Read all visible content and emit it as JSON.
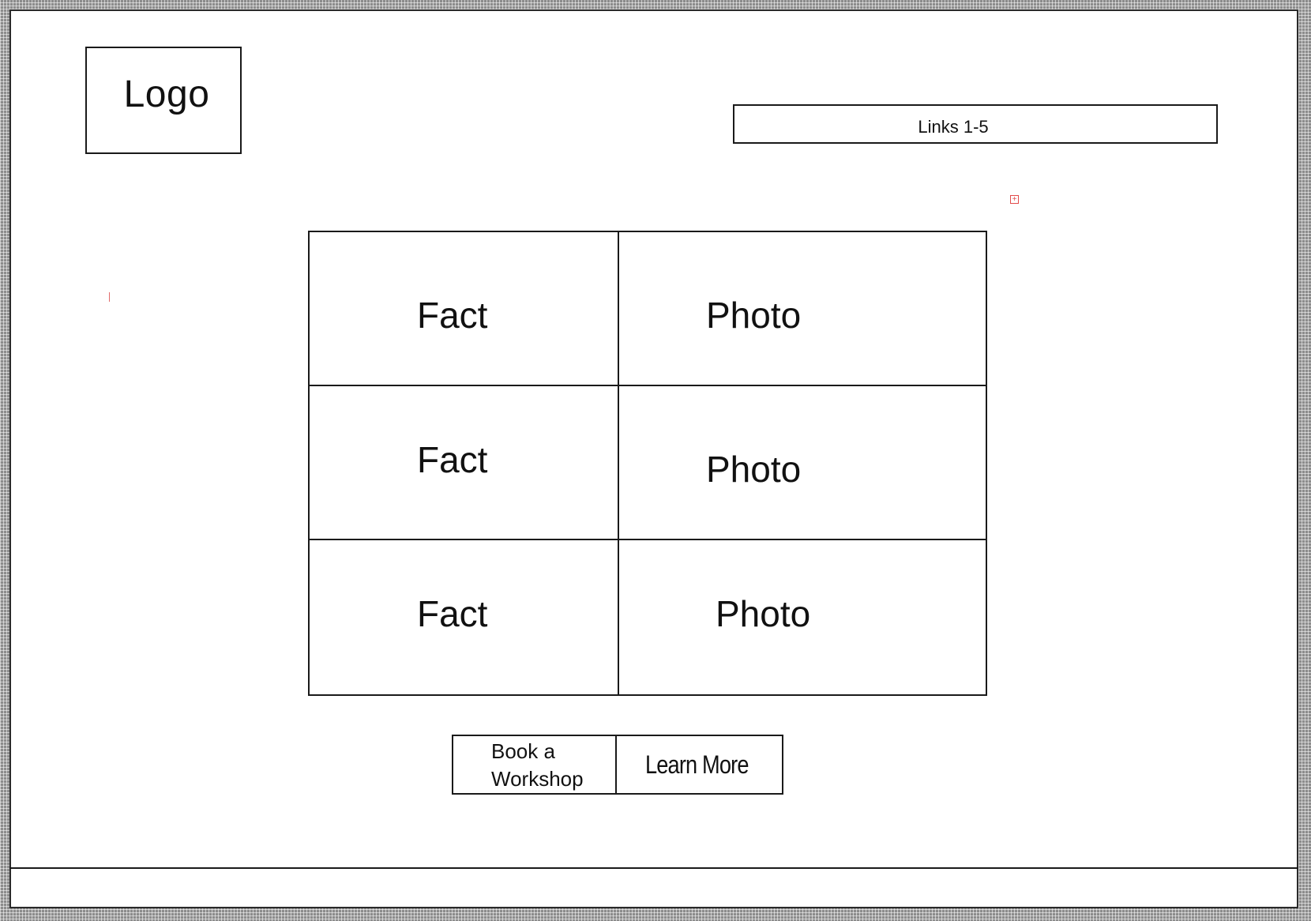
{
  "header": {
    "logo_label": "Logo",
    "links_label": "Links 1-5"
  },
  "grid": {
    "rows": [
      {
        "fact": "Fact",
        "photo": "Photo"
      },
      {
        "fact": "Fact",
        "photo": "Photo"
      },
      {
        "fact": "Fact",
        "photo": "Photo"
      }
    ]
  },
  "actions": {
    "book_label": "Book a\nWorkshop",
    "learn_label": "Learn More"
  },
  "icons": {
    "marker": "plus-square-icon"
  },
  "colors": {
    "stroke": "#1a1a1a",
    "marker": "#e24b4b",
    "background": "#ffffff"
  }
}
